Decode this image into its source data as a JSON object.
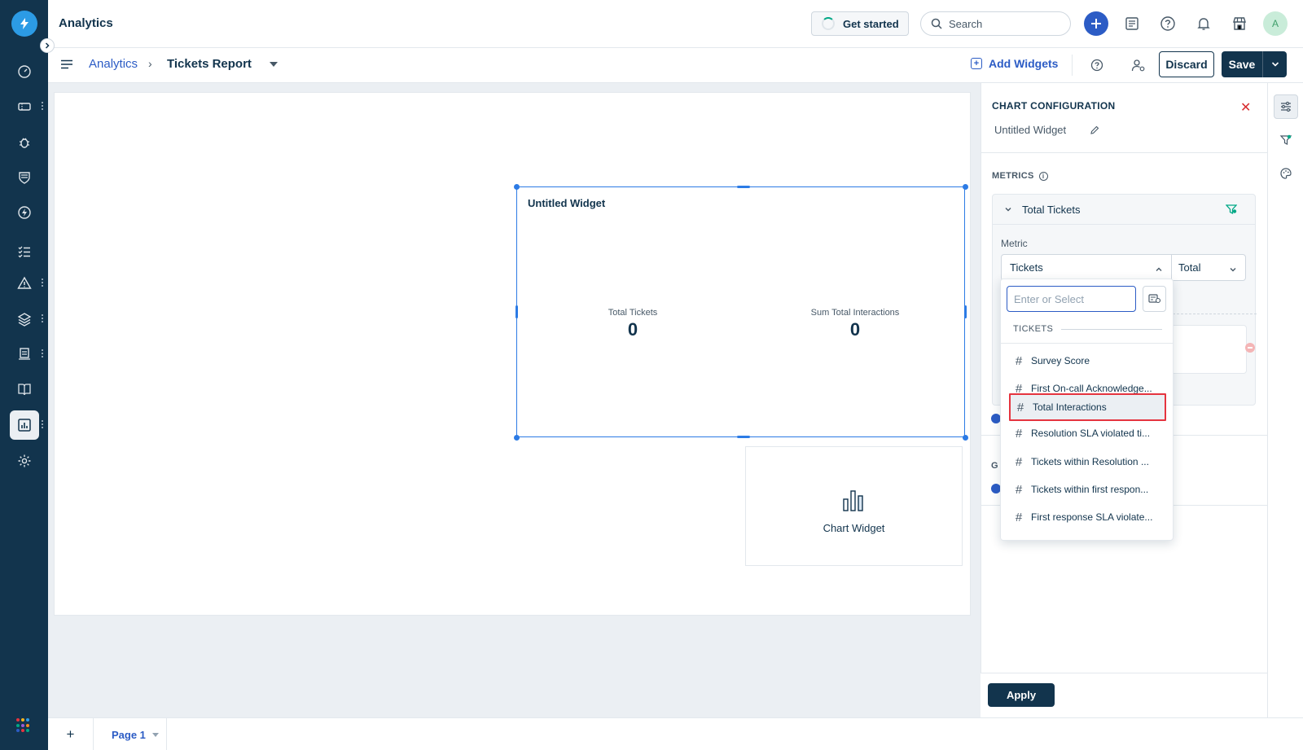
{
  "app": {
    "title": "Analytics"
  },
  "header": {
    "get_started": "Get started",
    "search_placeholder": "Search",
    "avatar_initial": "A"
  },
  "subheader": {
    "breadcrumb_root": "Analytics",
    "breadcrumb_sep": "›",
    "breadcrumb_current": "Tickets Report",
    "add_widgets": "Add Widgets",
    "discard": "Discard",
    "save": "Save"
  },
  "canvas": {
    "selected_widget": {
      "title": "Untitled Widget",
      "metrics": [
        {
          "label": "Total Tickets",
          "value": "0"
        },
        {
          "label": "Sum Total Interactions",
          "value": "0"
        }
      ]
    },
    "chart_widget": {
      "label": "Chart Widget"
    }
  },
  "config": {
    "heading": "CHART CONFIGURATION",
    "widget_name": "Untitled Widget",
    "metrics_label": "METRICS",
    "metric_card_title": "Total Tickets",
    "metric_field_label": "Metric",
    "metric_value": "Tickets",
    "aggregation_value": "Total",
    "group_letter": "G",
    "apply": "Apply"
  },
  "dropdown": {
    "placeholder": "Enter or Select",
    "group_label": "TICKETS",
    "items": [
      "Survey Score",
      "First On-call Acknowledge...",
      "Total Interactions",
      "Resolution SLA violated ti...",
      "Tickets within Resolution ...",
      "Tickets within first respon...",
      "First response SLA violate..."
    ],
    "highlighted_index": 2
  },
  "pages": {
    "add": "+",
    "current": "Page 1"
  },
  "colors": {
    "rail": "#12344d",
    "accent": "#2c5cc5",
    "selection": "#2c7be5",
    "highlight_border": "#e5343f",
    "primary_button": "#12344d"
  }
}
